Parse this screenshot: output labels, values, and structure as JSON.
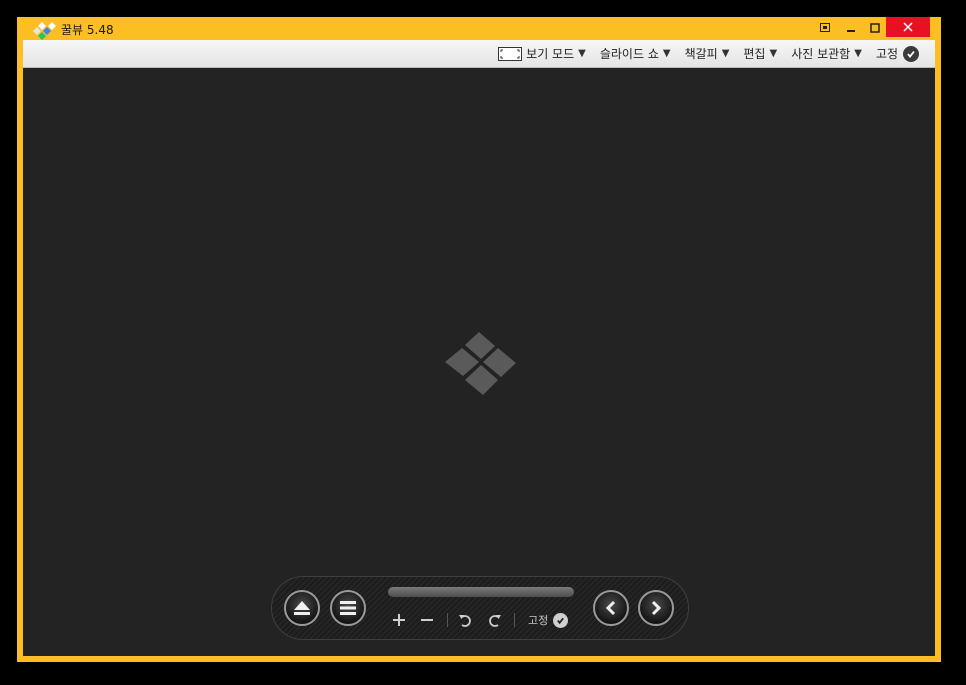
{
  "app": {
    "title": "꿀뷰 5.48"
  },
  "menubar": {
    "items": [
      {
        "label": "보기 모드",
        "icon": "frame-icon"
      },
      {
        "label": "슬라이드 쇼"
      },
      {
        "label": "책갈피"
      },
      {
        "label": "편집"
      },
      {
        "label": "사진 보관함"
      }
    ],
    "pin_label": "고정"
  },
  "toolbar": {
    "pin_label": "고정"
  },
  "colors": {
    "frame": "#fbbf24",
    "viewer_bg": "#232323",
    "close_button": "#e81123"
  }
}
